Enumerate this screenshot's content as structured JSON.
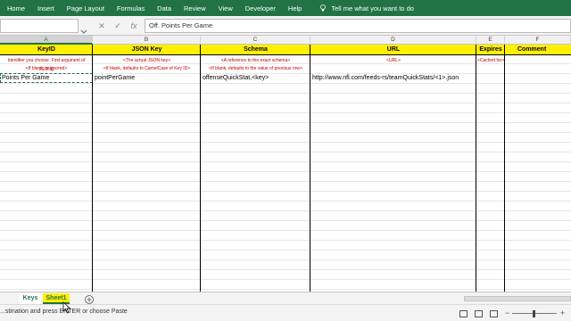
{
  "ribbon": {
    "tabs": [
      "Home",
      "Insert",
      "Page Layout",
      "Formulas",
      "Data",
      "Review",
      "View",
      "Developer",
      "Help"
    ],
    "tell_me": "Tell me what you want to do"
  },
  "formula_bar": {
    "cancel_icon": "cancel-icon",
    "enter_icon": "check-icon",
    "fx_label": "fx",
    "value": "Off. Points Per Game"
  },
  "columns": [
    "A",
    "B",
    "C",
    "D",
    "E",
    "F"
  ],
  "header_row": [
    "KeyID",
    "JSON Key",
    "Schema",
    "URL",
    "Expires",
    "Comment"
  ],
  "note_row_1": [
    "Identifier you choose. First argument of JSON()",
    "<The actual JSON key>",
    "<A reference to the exact schema>",
    "<URL>",
    "<Cached for>",
    ""
  ],
  "note_row_2": [
    "<If blank, is ignored>",
    "<If blank, defaults to CamelCase of Key ID>",
    "<If blank, defaults to the value of previous row>",
    "",
    "",
    ""
  ],
  "data_row": [
    "Points Per Game",
    "pointPerGame",
    "offenseQuickStat,<key>",
    "http://www.nfl.com/feeds-rs/teamQuickStats/<1>.json",
    "",
    ""
  ],
  "sheets": [
    "Keys",
    "Sheet1"
  ],
  "status": {
    "message": "...stination and press ENTER or choose Paste"
  },
  "colors": {
    "excel_green": "#217346",
    "header_yellow": "#ffef00",
    "note_red": "#c00000"
  }
}
